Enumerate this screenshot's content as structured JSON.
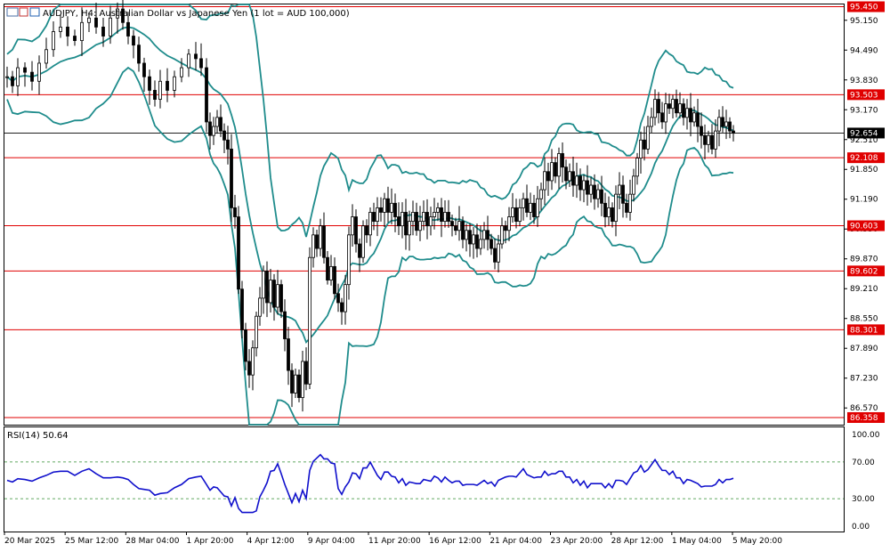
{
  "header": {
    "title": "AUDJPY, H4:  Australian Dollar vs Japanese Yen (1 lot = AUD 100,000)"
  },
  "rsi_panel": {
    "label": "RSI(14) 50.64"
  },
  "colors": {
    "candles": "#000000",
    "bollinger": "#1f8c8c",
    "levels": "#e00000",
    "rsi": "#1010cc",
    "rsi_guides": "#2e8b2e",
    "axis": "#000000"
  },
  "chart_data": [
    {
      "type": "candlestick",
      "symbol": "AUDJPY",
      "timeframe": "H4",
      "ylim": [
        86.2,
        95.5
      ],
      "y_ticks": [
        "95.150",
        "94.490",
        "93.830",
        "93.170",
        "92.510",
        "91.850",
        "91.190",
        "90.530",
        "89.870",
        "89.210",
        "88.550",
        "87.890",
        "87.230",
        "86.570"
      ],
      "x_ticks": [
        "20 Mar 2025",
        "25 Mar 12:00",
        "28 Mar 04:00",
        "1 Apr 20:00",
        "4 Apr 12:00",
        "9 Apr 04:00",
        "11 Apr 20:00",
        "16 Apr 12:00",
        "21 Apr 04:00",
        "23 Apr 20:00",
        "28 Apr 12:00",
        "1 May 04:00",
        "5 May 20:00"
      ],
      "horizontal_levels": [
        95.45,
        93.503,
        92.108,
        90.603,
        89.602,
        88.301,
        86.358
      ],
      "level_labels": [
        "95.450",
        "93.503",
        "92.108",
        "90.603",
        "89.602",
        "88.301",
        "86.358"
      ],
      "current_price": 92.654,
      "current_price_label": "92.654",
      "indicator": "Bollinger Bands",
      "close_series": [
        [
          0,
          93.9
        ],
        [
          6,
          93.7
        ],
        [
          12,
          94.1
        ],
        [
          20,
          94.0
        ],
        [
          28,
          93.8
        ],
        [
          36,
          94.2
        ],
        [
          44,
          94.5
        ],
        [
          52,
          94.9
        ],
        [
          60,
          95.0
        ],
        [
          68,
          94.8
        ],
        [
          76,
          94.7
        ],
        [
          84,
          95.1
        ],
        [
          92,
          95.2
        ],
        [
          100,
          95.0
        ],
        [
          108,
          94.8
        ],
        [
          116,
          95.2
        ],
        [
          124,
          95.4
        ],
        [
          130,
          95.1
        ],
        [
          136,
          94.8
        ],
        [
          142,
          94.6
        ],
        [
          148,
          94.2
        ],
        [
          154,
          93.9
        ],
        [
          160,
          93.6
        ],
        [
          166,
          93.4
        ],
        [
          172,
          93.8
        ],
        [
          180,
          93.6
        ],
        [
          188,
          93.9
        ],
        [
          196,
          94.1
        ],
        [
          204,
          94.4
        ],
        [
          212,
          94.3
        ],
        [
          218,
          94.1
        ],
        [
          224,
          92.9
        ],
        [
          228,
          92.6
        ],
        [
          232,
          92.8
        ],
        [
          236,
          93.0
        ],
        [
          240,
          92.7
        ],
        [
          244,
          92.5
        ],
        [
          248,
          92.3
        ],
        [
          252,
          91.0
        ],
        [
          256,
          90.8
        ],
        [
          260,
          89.2
        ],
        [
          264,
          88.3
        ],
        [
          268,
          87.6
        ],
        [
          272,
          87.3
        ],
        [
          276,
          87.9
        ],
        [
          280,
          88.6
        ],
        [
          284,
          89.0
        ],
        [
          288,
          89.6
        ],
        [
          292,
          88.9
        ],
        [
          296,
          89.4
        ],
        [
          300,
          88.8
        ],
        [
          304,
          89.3
        ],
        [
          308,
          88.7
        ],
        [
          312,
          88.1
        ],
        [
          316,
          87.4
        ],
        [
          320,
          86.9
        ],
        [
          324,
          87.3
        ],
        [
          328,
          86.8
        ],
        [
          332,
          87.6
        ],
        [
          336,
          87.1
        ],
        [
          340,
          89.9
        ],
        [
          344,
          90.4
        ],
        [
          348,
          90.1
        ],
        [
          352,
          90.6
        ],
        [
          356,
          89.9
        ],
        [
          360,
          89.4
        ],
        [
          364,
          89.7
        ],
        [
          368,
          89.1
        ],
        [
          372,
          88.9
        ],
        [
          376,
          88.7
        ],
        [
          380,
          89.3
        ],
        [
          384,
          90.4
        ],
        [
          388,
          90.8
        ],
        [
          392,
          90.2
        ],
        [
          396,
          89.9
        ],
        [
          400,
          90.6
        ],
        [
          404,
          90.4
        ],
        [
          408,
          90.9
        ],
        [
          412,
          90.7
        ],
        [
          416,
          91.0
        ],
        [
          420,
          90.9
        ],
        [
          424,
          91.2
        ],
        [
          428,
          90.9
        ],
        [
          432,
          91.1
        ],
        [
          436,
          90.8
        ],
        [
          440,
          90.6
        ],
        [
          444,
          90.9
        ],
        [
          448,
          90.4
        ],
        [
          452,
          90.7
        ],
        [
          456,
          90.9
        ],
        [
          460,
          90.5
        ],
        [
          464,
          90.7
        ],
        [
          468,
          90.9
        ],
        [
          472,
          90.6
        ],
        [
          476,
          90.8
        ],
        [
          480,
          90.9
        ],
        [
          484,
          91.0
        ],
        [
          488,
          90.7
        ],
        [
          492,
          90.9
        ],
        [
          496,
          90.7
        ],
        [
          500,
          90.6
        ],
        [
          504,
          90.5
        ],
        [
          508,
          90.7
        ],
        [
          512,
          90.3
        ],
        [
          516,
          90.5
        ],
        [
          520,
          90.2
        ],
        [
          524,
          90.4
        ],
        [
          528,
          90.1
        ],
        [
          532,
          90.3
        ],
        [
          536,
          90.5
        ],
        [
          540,
          90.3
        ],
        [
          544,
          90.1
        ],
        [
          548,
          89.8
        ],
        [
          552,
          90.2
        ],
        [
          556,
          90.6
        ],
        [
          560,
          90.5
        ],
        [
          564,
          90.8
        ],
        [
          568,
          91.0
        ],
        [
          572,
          90.7
        ],
        [
          576,
          91.0
        ],
        [
          580,
          91.2
        ],
        [
          584,
          90.9
        ],
        [
          588,
          91.1
        ],
        [
          592,
          90.8
        ],
        [
          596,
          91.2
        ],
        [
          600,
          91.4
        ],
        [
          604,
          91.8
        ],
        [
          608,
          91.6
        ],
        [
          612,
          92.0
        ],
        [
          616,
          91.7
        ],
        [
          620,
          92.2
        ],
        [
          624,
          91.9
        ],
        [
          628,
          91.6
        ],
        [
          632,
          91.8
        ],
        [
          636,
          91.5
        ],
        [
          640,
          91.7
        ],
        [
          644,
          91.4
        ],
        [
          648,
          91.6
        ],
        [
          652,
          91.3
        ],
        [
          656,
          91.5
        ],
        [
          660,
          91.2
        ],
        [
          664,
          91.4
        ],
        [
          668,
          91.1
        ],
        [
          672,
          90.8
        ],
        [
          676,
          91.0
        ],
        [
          680,
          90.7
        ],
        [
          684,
          91.3
        ],
        [
          688,
          91.5
        ],
        [
          692,
          91.1
        ],
        [
          696,
          90.9
        ],
        [
          700,
          91.3
        ],
        [
          704,
          91.7
        ],
        [
          708,
          92.1
        ],
        [
          712,
          92.5
        ],
        [
          716,
          92.3
        ],
        [
          720,
          92.8
        ],
        [
          724,
          93.0
        ],
        [
          728,
          93.4
        ],
        [
          732,
          93.1
        ],
        [
          736,
          92.9
        ],
        [
          740,
          93.3
        ],
        [
          744,
          93.2
        ],
        [
          748,
          93.4
        ],
        [
          752,
          93.1
        ],
        [
          756,
          93.3
        ],
        [
          760,
          93.0
        ],
        [
          764,
          93.2
        ],
        [
          768,
          92.9
        ],
        [
          772,
          93.1
        ],
        [
          776,
          92.8
        ],
        [
          780,
          92.6
        ],
        [
          784,
          92.4
        ],
        [
          788,
          92.6
        ],
        [
          792,
          92.3
        ],
        [
          796,
          92.7
        ],
        [
          800,
          93.0
        ],
        [
          804,
          92.8
        ],
        [
          808,
          92.9
        ],
        [
          812,
          92.7
        ],
        [
          816,
          92.65
        ]
      ]
    },
    {
      "type": "line",
      "name": "RSI(14)",
      "ylim": [
        0,
        100
      ],
      "y_ticks": [
        "100.00",
        "70.00",
        "30.00",
        "0.00"
      ],
      "guides": [
        70,
        30
      ],
      "last_value": 50.64
    }
  ]
}
